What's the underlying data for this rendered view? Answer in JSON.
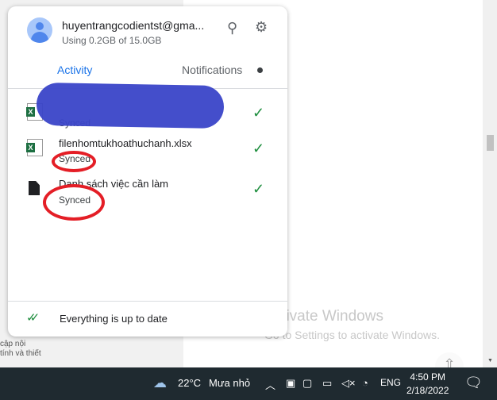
{
  "account": {
    "email": "huyentrangcodientst@gma...",
    "usage": "Using 0.2GB of 15.0GB"
  },
  "tabs": {
    "activity": "Activity",
    "notifications": "Notifications"
  },
  "files": [
    {
      "name": "",
      "status": "Synced",
      "type": "excel"
    },
    {
      "name": "filenhomtukhoathuchanh.xlsx",
      "status": "Synced",
      "type": "excel"
    },
    {
      "name": "Danh sách việc cần làm",
      "status": "Synced",
      "type": "document"
    }
  ],
  "footer": {
    "status": "Everything is up to date"
  },
  "background": {
    "line1": "cập nội",
    "line2": "tính và thiết"
  },
  "watermark": {
    "title": "Activate Windows",
    "subtitle": "Go to Settings to activate Windows."
  },
  "taskbar": {
    "temperature": "22°C",
    "weather": "Mưa nhỏ",
    "language": "ENG",
    "time": "4:50 PM",
    "date": "2/18/2022"
  },
  "colors": {
    "accent": "#1a73e8",
    "success": "#1e8e3e",
    "annotation": "#e41e26",
    "redaction": "#3a45c8"
  }
}
